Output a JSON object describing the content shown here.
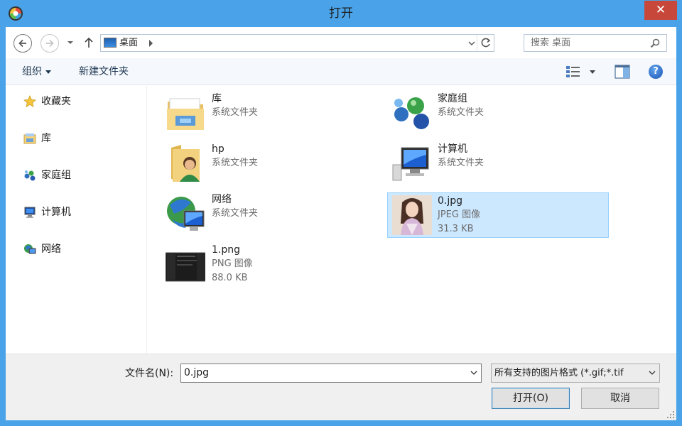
{
  "window": {
    "title": "打开",
    "close_glyph": "✕"
  },
  "nav": {
    "address": "桌面",
    "search_placeholder": "搜索 桌面"
  },
  "toolbar": {
    "organize": "组织",
    "new_folder": "新建文件夹"
  },
  "sidebar": {
    "items": [
      {
        "label": "收藏夹",
        "icon": "star-icon"
      },
      {
        "label": "库",
        "icon": "library-icon"
      },
      {
        "label": "家庭组",
        "icon": "homegroup-icon"
      },
      {
        "label": "计算机",
        "icon": "computer-icon"
      },
      {
        "label": "网络",
        "icon": "network-icon"
      }
    ]
  },
  "files": [
    {
      "name": "库",
      "type": "系统文件夹",
      "icon": "library-folder-icon"
    },
    {
      "name": "家庭组",
      "type": "系统文件夹",
      "icon": "homegroup-icon"
    },
    {
      "name": "hp",
      "type": "系统文件夹",
      "icon": "user-folder-icon"
    },
    {
      "name": "计算机",
      "type": "系统文件夹",
      "icon": "computer-icon"
    },
    {
      "name": "网络",
      "type": "系统文件夹",
      "icon": "network-icon"
    },
    {
      "name": "0.jpg",
      "type": "JPEG 图像",
      "size": "31.3 KB",
      "icon": "image-thumbnail",
      "selected": true
    },
    {
      "name": "1.png",
      "type": "PNG 图像",
      "size": "88.0 KB",
      "icon": "screenshot-thumbnail"
    }
  ],
  "bottom": {
    "filename_label": "文件名(N):",
    "filename_value": "0.jpg",
    "filetype_value": "所有支持的图片格式 (*.gif;*.tif",
    "open_label": "打开(O)",
    "cancel_label": "取消"
  }
}
